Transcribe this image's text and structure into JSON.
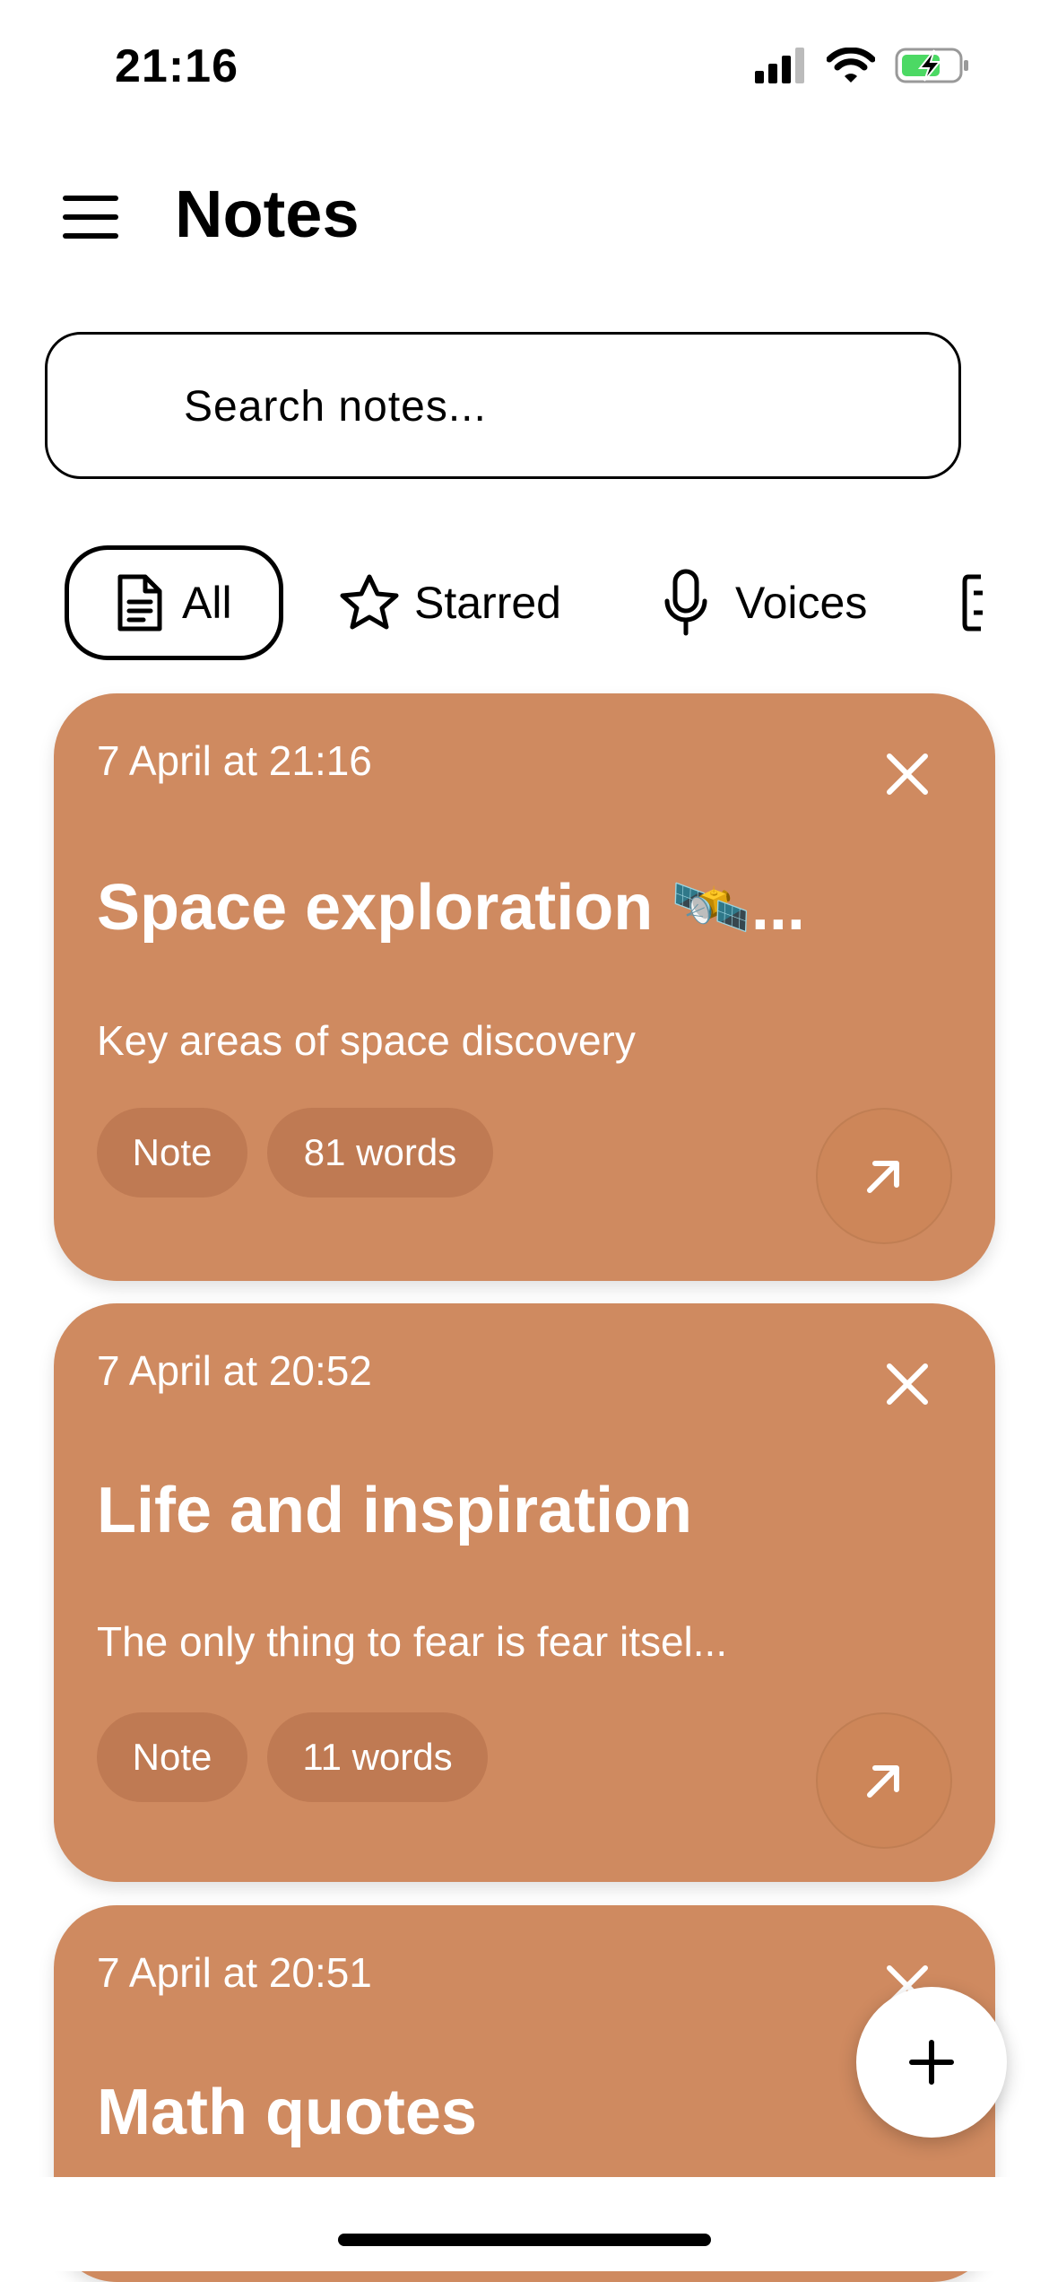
{
  "status_bar": {
    "time": "21:16"
  },
  "header": {
    "title": "Notes"
  },
  "search": {
    "placeholder": "Search notes..."
  },
  "filters": [
    {
      "label": "All",
      "icon": "document-icon",
      "active": true
    },
    {
      "label": "Starred",
      "icon": "star-icon",
      "active": false
    },
    {
      "label": "Voices",
      "icon": "microphone-icon",
      "active": false
    }
  ],
  "notes": [
    {
      "date": "7 April at 21:16",
      "title": "Space exploration 🛰️...",
      "description": "Key areas of space discovery",
      "type": "Note",
      "word_count": "81 words"
    },
    {
      "date": "7 April at 20:52",
      "title": "Life and inspiration",
      "description": "The only thing to fear is fear itsel...",
      "type": "Note",
      "word_count": "11 words"
    },
    {
      "date": "7 April at 20:51",
      "title": "Math quotes"
    }
  ],
  "colors": {
    "card": "#cf8a60",
    "tag": "#bf7a53",
    "battery": "#4cd964"
  }
}
